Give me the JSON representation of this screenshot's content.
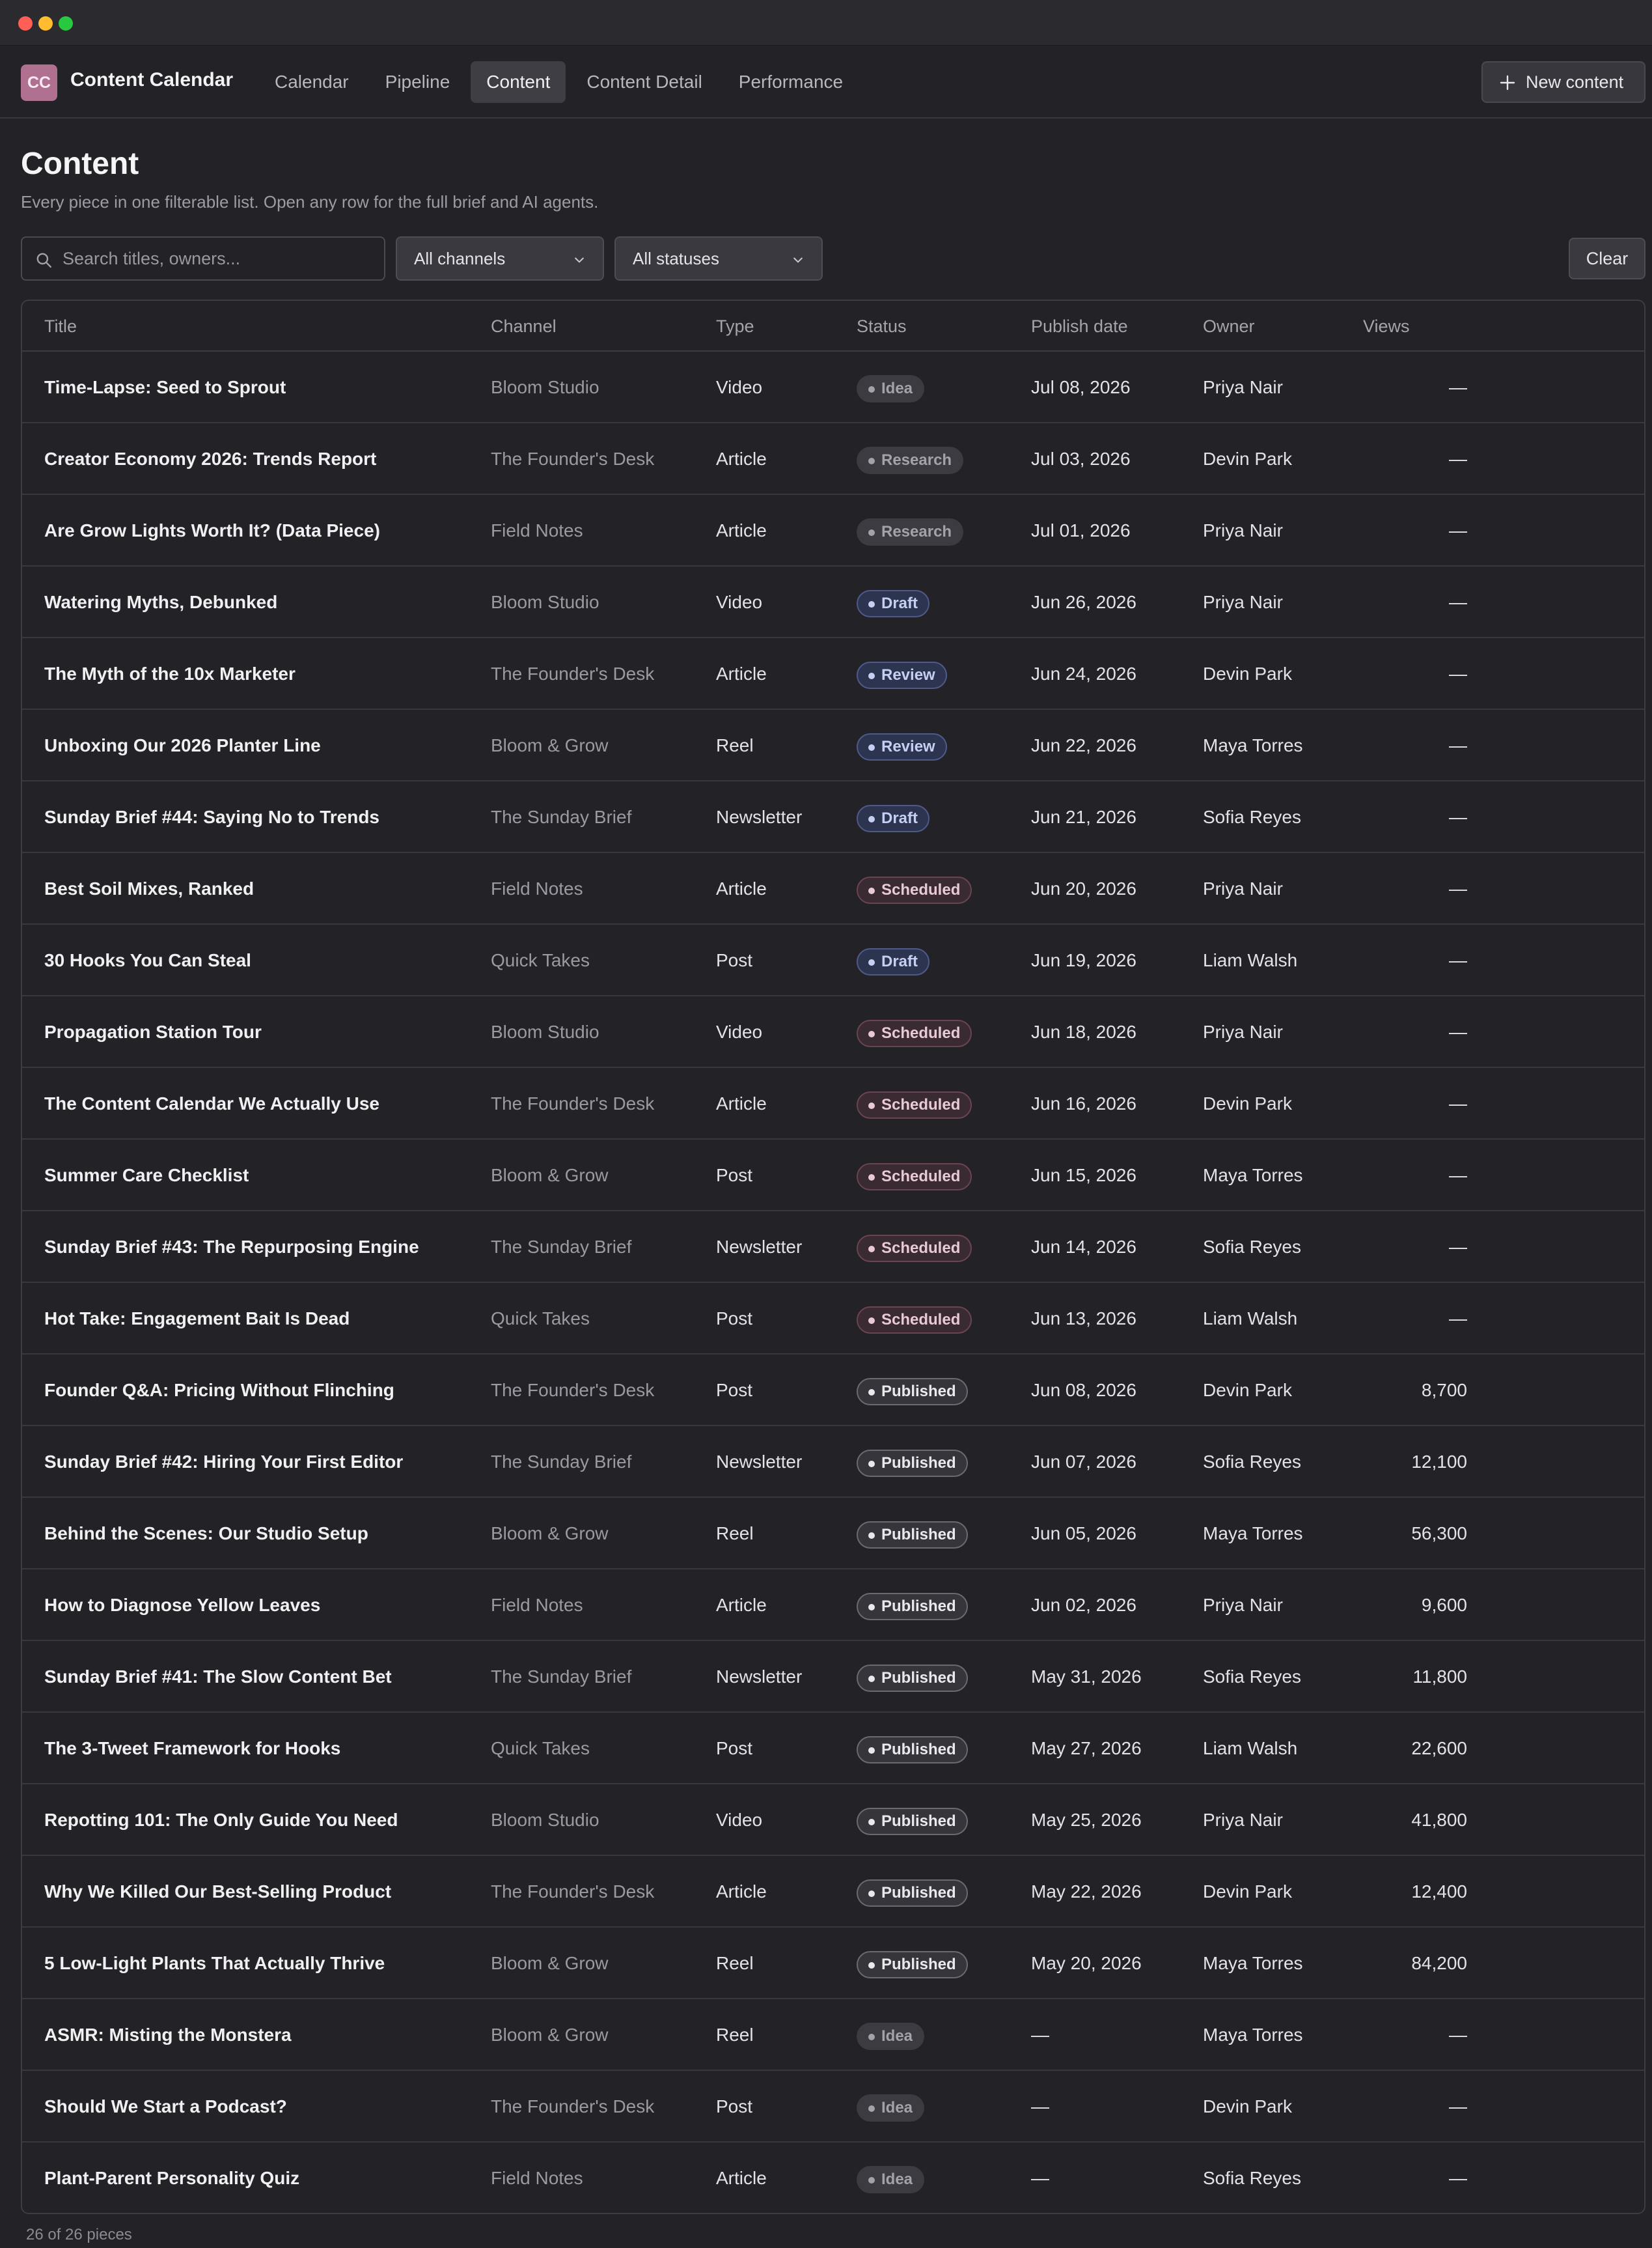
{
  "app": {
    "logo_text": "CC",
    "title": "Content Calendar",
    "accent": "#b0708f"
  },
  "nav": {
    "tabs": [
      {
        "label": "Calendar",
        "active": false
      },
      {
        "label": "Pipeline",
        "active": false
      },
      {
        "label": "Content",
        "active": true
      },
      {
        "label": "Content Detail",
        "active": false
      },
      {
        "label": "Performance",
        "active": false
      }
    ],
    "new_button": "New content"
  },
  "page": {
    "title": "Content",
    "subtitle": "Every piece in one filterable list. Open any row for the full brief and AI agents."
  },
  "filters": {
    "search_placeholder": "Search titles, owners...",
    "search_value": "",
    "channel_selected": "All channels",
    "status_selected": "All statuses",
    "clear_label": "Clear"
  },
  "table": {
    "columns": [
      "Title",
      "Channel",
      "Type",
      "Status",
      "Publish date",
      "Owner",
      "Views"
    ],
    "rows": [
      {
        "title": "Time-Lapse: Seed to Sprout",
        "channel": "Bloom Studio",
        "type": "Video",
        "status": "Idea",
        "date": "Jul 08, 2026",
        "owner": "Priya Nair",
        "views": "—"
      },
      {
        "title": "Creator Economy 2026: Trends Report",
        "channel": "The Founder's Desk",
        "type": "Article",
        "status": "Research",
        "date": "Jul 03, 2026",
        "owner": "Devin Park",
        "views": "—"
      },
      {
        "title": "Are Grow Lights Worth It? (Data Piece)",
        "channel": "Field Notes",
        "type": "Article",
        "status": "Research",
        "date": "Jul 01, 2026",
        "owner": "Priya Nair",
        "views": "—"
      },
      {
        "title": "Watering Myths, Debunked",
        "channel": "Bloom Studio",
        "type": "Video",
        "status": "Draft",
        "date": "Jun 26, 2026",
        "owner": "Priya Nair",
        "views": "—"
      },
      {
        "title": "The Myth of the 10x Marketer",
        "channel": "The Founder's Desk",
        "type": "Article",
        "status": "Review",
        "date": "Jun 24, 2026",
        "owner": "Devin Park",
        "views": "—"
      },
      {
        "title": "Unboxing Our 2026 Planter Line",
        "channel": "Bloom & Grow",
        "type": "Reel",
        "status": "Review",
        "date": "Jun 22, 2026",
        "owner": "Maya Torres",
        "views": "—"
      },
      {
        "title": "Sunday Brief #44: Saying No to Trends",
        "channel": "The Sunday Brief",
        "type": "Newsletter",
        "status": "Draft",
        "date": "Jun 21, 2026",
        "owner": "Sofia Reyes",
        "views": "—"
      },
      {
        "title": "Best Soil Mixes, Ranked",
        "channel": "Field Notes",
        "type": "Article",
        "status": "Scheduled",
        "date": "Jun 20, 2026",
        "owner": "Priya Nair",
        "views": "—"
      },
      {
        "title": "30 Hooks You Can Steal",
        "channel": "Quick Takes",
        "type": "Post",
        "status": "Draft",
        "date": "Jun 19, 2026",
        "owner": "Liam Walsh",
        "views": "—"
      },
      {
        "title": "Propagation Station Tour",
        "channel": "Bloom Studio",
        "type": "Video",
        "status": "Scheduled",
        "date": "Jun 18, 2026",
        "owner": "Priya Nair",
        "views": "—"
      },
      {
        "title": "The Content Calendar We Actually Use",
        "channel": "The Founder's Desk",
        "type": "Article",
        "status": "Scheduled",
        "date": "Jun 16, 2026",
        "owner": "Devin Park",
        "views": "—"
      },
      {
        "title": "Summer Care Checklist",
        "channel": "Bloom & Grow",
        "type": "Post",
        "status": "Scheduled",
        "date": "Jun 15, 2026",
        "owner": "Maya Torres",
        "views": "—"
      },
      {
        "title": "Sunday Brief #43: The Repurposing Engine",
        "channel": "The Sunday Brief",
        "type": "Newsletter",
        "status": "Scheduled",
        "date": "Jun 14, 2026",
        "owner": "Sofia Reyes",
        "views": "—"
      },
      {
        "title": "Hot Take: Engagement Bait Is Dead",
        "channel": "Quick Takes",
        "type": "Post",
        "status": "Scheduled",
        "date": "Jun 13, 2026",
        "owner": "Liam Walsh",
        "views": "—"
      },
      {
        "title": "Founder Q&A: Pricing Without Flinching",
        "channel": "The Founder's Desk",
        "type": "Post",
        "status": "Published",
        "date": "Jun 08, 2026",
        "owner": "Devin Park",
        "views": "8,700"
      },
      {
        "title": "Sunday Brief #42: Hiring Your First Editor",
        "channel": "The Sunday Brief",
        "type": "Newsletter",
        "status": "Published",
        "date": "Jun 07, 2026",
        "owner": "Sofia Reyes",
        "views": "12,100"
      },
      {
        "title": "Behind the Scenes: Our Studio Setup",
        "channel": "Bloom & Grow",
        "type": "Reel",
        "status": "Published",
        "date": "Jun 05, 2026",
        "owner": "Maya Torres",
        "views": "56,300"
      },
      {
        "title": "How to Diagnose Yellow Leaves",
        "channel": "Field Notes",
        "type": "Article",
        "status": "Published",
        "date": "Jun 02, 2026",
        "owner": "Priya Nair",
        "views": "9,600"
      },
      {
        "title": "Sunday Brief #41: The Slow Content Bet",
        "channel": "The Sunday Brief",
        "type": "Newsletter",
        "status": "Published",
        "date": "May 31, 2026",
        "owner": "Sofia Reyes",
        "views": "11,800"
      },
      {
        "title": "The 3-Tweet Framework for Hooks",
        "channel": "Quick Takes",
        "type": "Post",
        "status": "Published",
        "date": "May 27, 2026",
        "owner": "Liam Walsh",
        "views": "22,600"
      },
      {
        "title": "Repotting 101: The Only Guide You Need",
        "channel": "Bloom Studio",
        "type": "Video",
        "status": "Published",
        "date": "May 25, 2026",
        "owner": "Priya Nair",
        "views": "41,800"
      },
      {
        "title": "Why We Killed Our Best-Selling Product",
        "channel": "The Founder's Desk",
        "type": "Article",
        "status": "Published",
        "date": "May 22, 2026",
        "owner": "Devin Park",
        "views": "12,400"
      },
      {
        "title": "5 Low-Light Plants That Actually Thrive",
        "channel": "Bloom & Grow",
        "type": "Reel",
        "status": "Published",
        "date": "May 20, 2026",
        "owner": "Maya Torres",
        "views": "84,200"
      },
      {
        "title": "ASMR: Misting the Monstera",
        "channel": "Bloom & Grow",
        "type": "Reel",
        "status": "Idea",
        "date": "—",
        "owner": "Maya Torres",
        "views": "—"
      },
      {
        "title": "Should We Start a Podcast?",
        "channel": "The Founder's Desk",
        "type": "Post",
        "status": "Idea",
        "date": "—",
        "owner": "Devin Park",
        "views": "—"
      },
      {
        "title": "Plant-Parent Personality Quiz",
        "channel": "Field Notes",
        "type": "Article",
        "status": "Idea",
        "date": "—",
        "owner": "Sofia Reyes",
        "views": "—"
      }
    ]
  },
  "footer": {
    "count_text": "26 of 26 pieces"
  },
  "icons": {
    "new_button": "plus-icon",
    "search": "search-icon",
    "select": "chevron-down-icon"
  }
}
